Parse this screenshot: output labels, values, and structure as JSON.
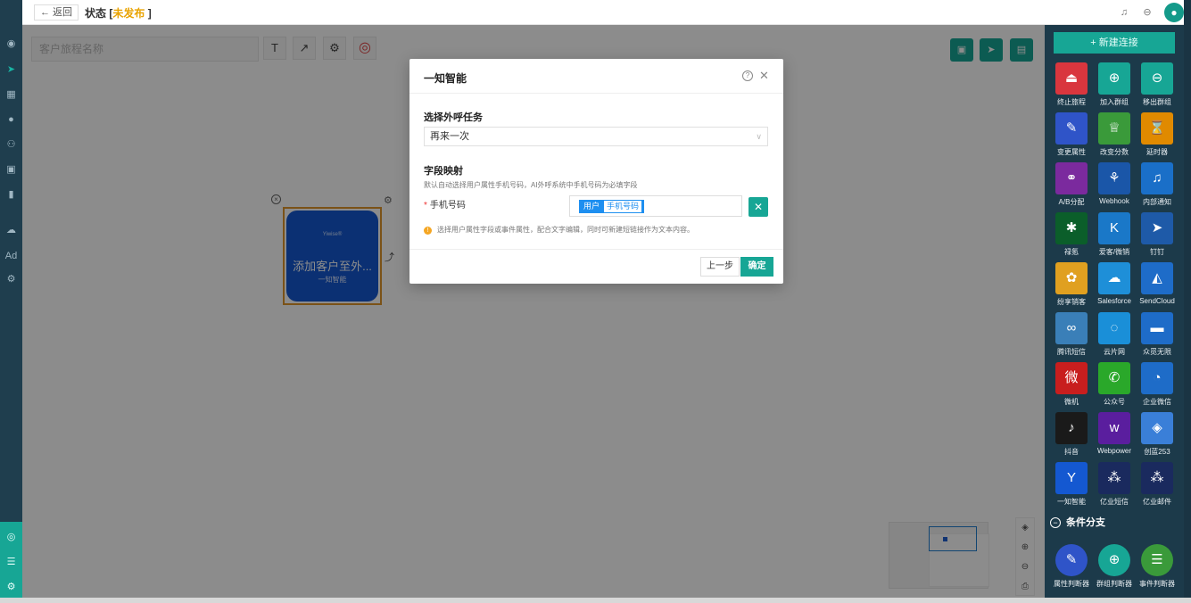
{
  "topbar": {
    "back_label": "← 返回",
    "status_label": "状态 [",
    "status_value": "未发布",
    "status_end": " ]",
    "icons": [
      "bell-icon",
      "more-icon",
      "user-avatar"
    ]
  },
  "canvas": {
    "name_placeholder": "客户旅程名称",
    "tools": [
      "T",
      "↗",
      "⚙",
      "◎"
    ],
    "node": {
      "brand": "Yiwise®",
      "title": "添加客户至外...",
      "subtitle": "一知智能"
    }
  },
  "right_panel": {
    "new_connection": "+ 新建连接",
    "items": [
      {
        "label": "终止旅程",
        "icon": "⏏",
        "color": "#d9363e"
      },
      {
        "label": "加入群组",
        "icon": "⊕",
        "color": "#17a695"
      },
      {
        "label": "移出群组",
        "icon": "⊖",
        "color": "#17a695"
      },
      {
        "label": "变更属性",
        "icon": "✎",
        "color": "#2f54c8"
      },
      {
        "label": "改变分数",
        "icon": "♕",
        "color": "#3a9a3a"
      },
      {
        "label": "延时器",
        "icon": "⌛",
        "color": "#e08a00"
      },
      {
        "label": "A/B分配",
        "icon": "⚭",
        "color": "#7b2a9e"
      },
      {
        "label": "Webhook",
        "icon": "⚘",
        "color": "#1a56a8"
      },
      {
        "label": "内部通知",
        "icon": "♫",
        "color": "#1a6fc8"
      },
      {
        "label": "禄氪",
        "icon": "✱",
        "color": "#0b5e2a"
      },
      {
        "label": "爱客/微销",
        "icon": "K",
        "color": "#1a78c8"
      },
      {
        "label": "钉钉",
        "icon": "➤",
        "color": "#1e5aa8"
      },
      {
        "label": "纷享销客",
        "icon": "✿",
        "color": "#e0a020"
      },
      {
        "label": "Salesforce",
        "icon": "☁",
        "color": "#1e8fd8"
      },
      {
        "label": "SendCloud",
        "icon": "◭",
        "color": "#1e6cc8"
      },
      {
        "label": "腾讯短信",
        "icon": "∞",
        "color": "#3a7fb8"
      },
      {
        "label": "云片网",
        "icon": "◌",
        "color": "#1a8fd8"
      },
      {
        "label": "众觅无限",
        "icon": "▬",
        "color": "#1e6cc8"
      },
      {
        "label": "微机",
        "icon": "微",
        "color": "#c81e1e"
      },
      {
        "label": "公众号",
        "icon": "✆",
        "color": "#2aa82a"
      },
      {
        "label": "企业微信",
        "icon": "◔",
        "color": "#1e6cc8"
      },
      {
        "label": "抖音",
        "icon": "♪",
        "color": "#1a1a1a"
      },
      {
        "label": "Webpower",
        "icon": "w",
        "color": "#5a1e9e"
      },
      {
        "label": "创蓝253",
        "icon": "◈",
        "color": "#3a7fd8"
      },
      {
        "label": "一知智能",
        "icon": "Y",
        "color": "#1458d1"
      },
      {
        "label": "亿业短信",
        "icon": "⁂",
        "color": "#1a2a5e"
      },
      {
        "label": "亿业邮件",
        "icon": "⁂",
        "color": "#1a2a5e"
      }
    ],
    "section_title": "条件分支",
    "conditions": [
      {
        "label": "属性判断器",
        "icon": "✎",
        "color": "#2f54c8"
      },
      {
        "label": "群组判断器",
        "icon": "⊕",
        "color": "#17a695"
      },
      {
        "label": "事件判断器",
        "icon": "☰",
        "color": "#3a9a3a"
      }
    ]
  },
  "dialog": {
    "title": "一知智能",
    "task_label": "选择外呼任务",
    "task_value": "再来一次",
    "mapping_label": "字段映射",
    "mapping_hint": "默认自动选择用户属性手机号码，AI外呼系统中手机号码为必填字段",
    "phone_label": "手机号码",
    "phone_tag_source": "用户",
    "phone_tag_value": "手机号码",
    "notice": "选择用户属性字段或事件属性，配合文字编辑，同时可新建短链接作为文本内容。",
    "prev_label": "上一步",
    "ok_label": "确定"
  }
}
